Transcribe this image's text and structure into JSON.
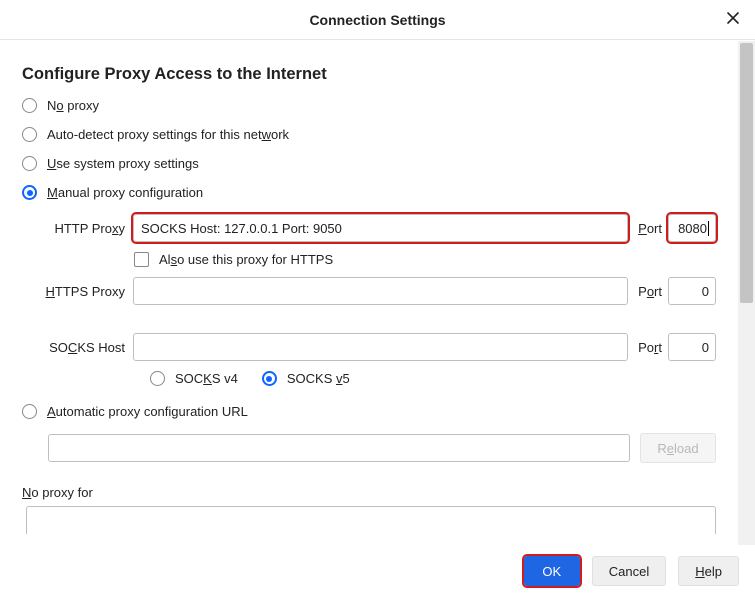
{
  "title": "Connection Settings",
  "heading": "Configure Proxy Access to the Internet",
  "opt_no_proxy": {
    "pre": "N",
    "u": "o",
    "post": " proxy"
  },
  "opt_auto_detect": {
    "pre": "Auto-detect proxy settings for this net",
    "u": "w",
    "post": "ork"
  },
  "opt_system": {
    "pre": "",
    "u": "U",
    "post": "se system proxy settings"
  },
  "opt_manual": {
    "pre": "",
    "u": "M",
    "post": "anual proxy configuration"
  },
  "opt_auto_url": {
    "pre": "",
    "u": "A",
    "post": "utomatic proxy configuration URL"
  },
  "http_proxy": {
    "label": {
      "pre": "HTTP Pro",
      "u": "x",
      "post": "y"
    },
    "value": "SOCKS Host: 127.0.0.1 Port: 9050",
    "port_label": {
      "pre": "",
      "u": "P",
      "post": "ort"
    },
    "port": "8080"
  },
  "also_https": {
    "pre": "Al",
    "u": "s",
    "post": "o use this proxy for HTTPS"
  },
  "https_proxy": {
    "label": {
      "pre": "",
      "u": "H",
      "post": "TTPS Proxy"
    },
    "value": "",
    "port_label": {
      "pre": "P",
      "u": "o",
      "post": "rt"
    },
    "port": "0"
  },
  "socks_host": {
    "label": {
      "pre": "SO",
      "u": "C",
      "post": "KS Host"
    },
    "value": "",
    "port_label": {
      "pre": "Po",
      "u": "r",
      "post": "t"
    },
    "port": "0"
  },
  "socks_v4": {
    "pre": "SOC",
    "u": "K",
    "post": "S v4"
  },
  "socks_v5": {
    "pre": "SOCKS ",
    "u": "v",
    "post": "5"
  },
  "reload": {
    "pre": "R",
    "u": "e",
    "post": "load"
  },
  "no_proxy_for": {
    "pre": "",
    "u": "N",
    "post": "o proxy for"
  },
  "footer": {
    "ok": "OK",
    "cancel": "Cancel",
    "help": {
      "pre": "",
      "u": "H",
      "post": "elp"
    }
  }
}
